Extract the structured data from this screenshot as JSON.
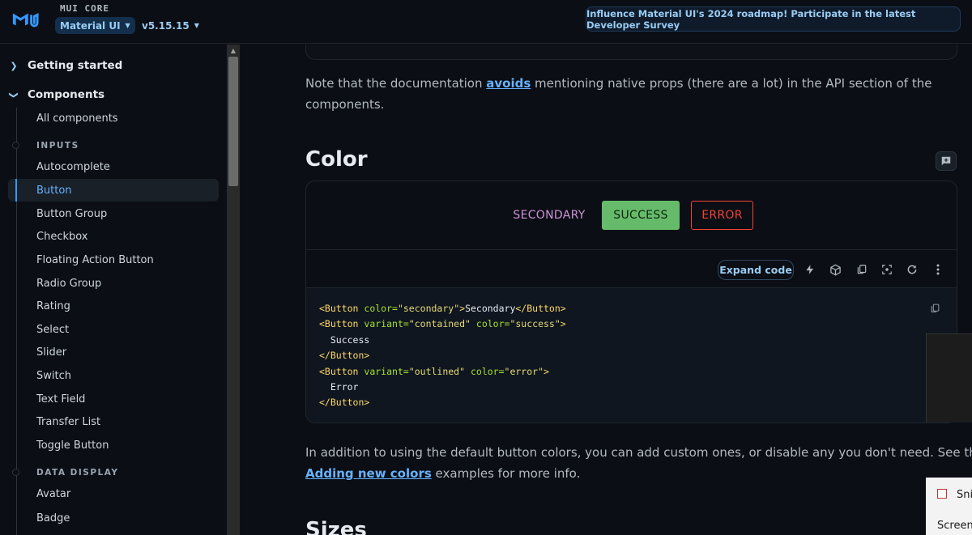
{
  "header": {
    "brand": "MUI CORE",
    "product": "Material UI",
    "version": "v5.15.15",
    "banner": "Influence Material UI's 2024 roadmap! Participate in the latest Developer Survey"
  },
  "sidebar": {
    "groups": [
      "Getting started",
      "Components"
    ],
    "all_components": "All components",
    "section_inputs": "INPUTS",
    "inputs": [
      "Autocomplete",
      "Button",
      "Button Group",
      "Checkbox",
      "Floating Action Button",
      "Radio Group",
      "Rating",
      "Select",
      "Slider",
      "Switch",
      "Text Field",
      "Transfer List",
      "Toggle Button"
    ],
    "section_data_display": "DATA DISPLAY",
    "data_display": [
      "Avatar",
      "Badge"
    ],
    "active_item": "Button"
  },
  "main": {
    "note_pre": "Note that the documentation ",
    "note_link": "avoids",
    "note_post": " mentioning native props (there are a lot) in the API section of the components.",
    "color_heading": "Color",
    "buttons": {
      "secondary": "SECONDARY",
      "success": "SUCCESS",
      "error": "ERROR"
    },
    "expand_code": "Expand code",
    "toolbar_icons": [
      "bolt-icon",
      "cube-icon",
      "copy-icon",
      "screenshot-icon",
      "reload-icon",
      "more-vert-icon"
    ],
    "code": {
      "l1_text": "Secondary",
      "success_text": "Success",
      "error_text": "Error"
    },
    "para2_pre": "In addition to using the default button colors, you can add custom ones, or disable any you don't need. See th",
    "para2_link": "Adding new colors",
    "para2_post": " examples for more info.",
    "sizes_heading": "Sizes"
  },
  "overlay": {
    "menu_item_1": "Snip",
    "menu_item_2": "Screen"
  },
  "colors": {
    "accent": "#66b2ff",
    "success": "#66bb6a",
    "error": "#f44336",
    "secondary": "#ce93d8"
  }
}
